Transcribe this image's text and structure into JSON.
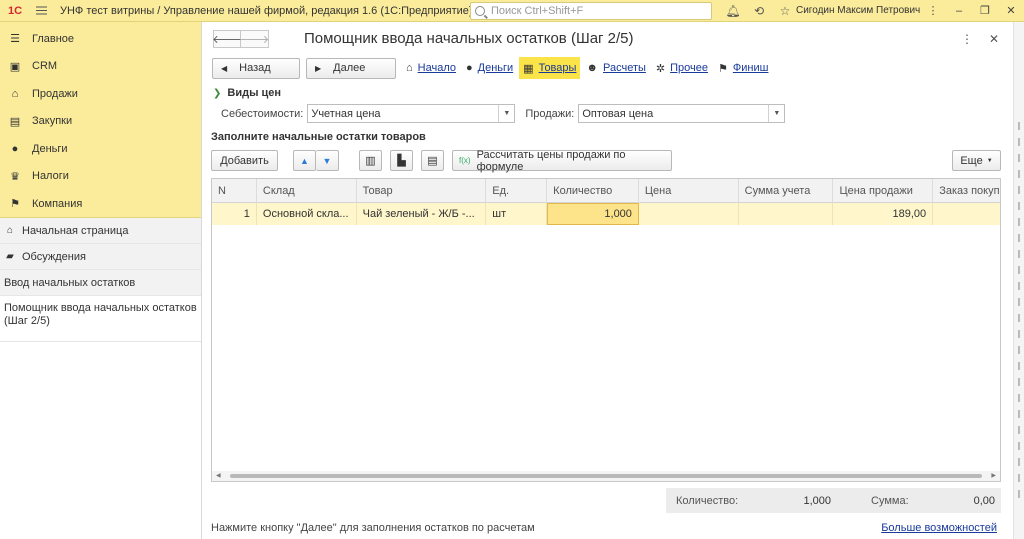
{
  "topbar": {
    "logo": "1С",
    "app_title": "УНФ тест витрины / Управление нашей фирмой, редакция 1.6  (1С:Предприятие)",
    "search_placeholder": "Поиск Ctrl+Shift+F",
    "user": "Сигодин Максим Петрович"
  },
  "sidebar": {
    "sections": [
      {
        "label": "Главное",
        "icon": "menu-icon"
      },
      {
        "label": "CRM",
        "icon": "crm-icon"
      },
      {
        "label": "Продажи",
        "icon": "sales-icon"
      },
      {
        "label": "Закупки",
        "icon": "purchases-icon"
      },
      {
        "label": "Деньги",
        "icon": "money-icon"
      },
      {
        "label": "Налоги",
        "icon": "taxes-icon"
      },
      {
        "label": "Компания",
        "icon": "company-flag-icon"
      }
    ],
    "nav": {
      "home": "Начальная страница",
      "discussions": "Обсуждения",
      "opening_balances": "Ввод начальных остатков",
      "active": "Помощник ввода начальных остатков (Шаг 2/5)"
    }
  },
  "form": {
    "title": "Помощник ввода начальных остатков (Шаг 2/5)",
    "back_label": "Назад",
    "next_label": "Далее",
    "steps": [
      {
        "label": "Начало",
        "icon": "house-icon",
        "active": false
      },
      {
        "label": "Деньги",
        "icon": "ruble-icon",
        "active": false
      },
      {
        "label": "Товары",
        "icon": "goods-icon",
        "active": true
      },
      {
        "label": "Расчеты",
        "icon": "people-icon",
        "active": false
      },
      {
        "label": "Прочее",
        "icon": "gear-icon",
        "active": false
      },
      {
        "label": "Финиш",
        "icon": "flag-icon",
        "active": false
      }
    ],
    "price_types": {
      "group_title": "Виды цен",
      "cost_label": "Себестоимости:",
      "cost_value": "Учетная цена",
      "sales_label": "Продажи:",
      "sales_value": "Оптовая цена"
    },
    "goods_section_title": "Заполните начальные остатки товаров",
    "toolbar": {
      "add_label": "Добавить",
      "calc_prices_label": "Рассчитать цены продажи по формуле",
      "more_label": "Еще"
    },
    "table": {
      "columns": [
        "N",
        "Склад",
        "Товар",
        "Ед.",
        "Количество",
        "Цена",
        "Сумма учета",
        "Цена продажи",
        "Заказ покуп"
      ],
      "rows": [
        [
          "1",
          "Основной скла...",
          "Чай зеленый - Ж/Б  -...",
          "шт",
          "1,000",
          "",
          "",
          "189,00",
          ""
        ]
      ]
    },
    "totals": {
      "qty_label": "Количество:",
      "qty_value": "1,000",
      "sum_label": "Сумма:",
      "sum_value": "0,00"
    },
    "hint": "Нажмите кнопку \"Далее\" для заполнения остатков по расчетам",
    "more_link": "Больше возможностей"
  }
}
